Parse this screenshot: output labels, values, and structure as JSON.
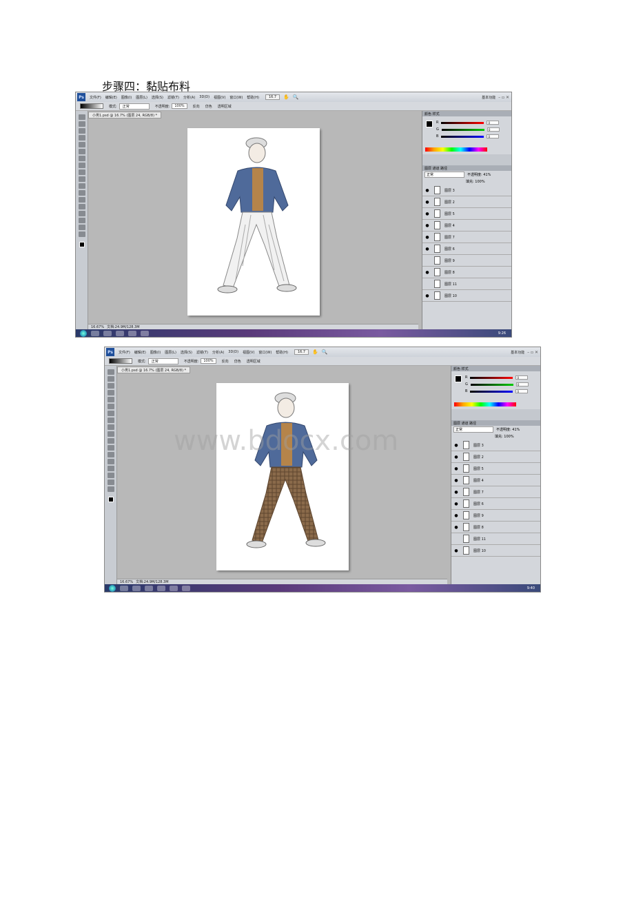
{
  "heading": "步骤四：黏贴布料",
  "watermark": "www.bdocx.com",
  "menu": [
    "文件(F)",
    "编辑(E)",
    "图像(I)",
    "图层(L)",
    "选择(S)",
    "滤镜(T)",
    "分析(A)",
    "3D(D)",
    "视图(V)",
    "窗口(W)",
    "帮助(H)"
  ],
  "zoom_menu": "16.7",
  "workspace": "基本功能",
  "options": {
    "mode_label": "模式:",
    "mode_value": "正常",
    "opacity_label": "不透明度:",
    "opacity_value": "100%",
    "reverse": "反向",
    "dither": "仿色",
    "transparency": "透明区域"
  },
  "doc_tab": "小男1.psd @ 16.7% (图层 24, RGB/8) *",
  "status": {
    "zoom": "16.67%",
    "doc": "文档:24.9M/128.3M"
  },
  "color_panel": {
    "tabs": "颜色  样式",
    "r": "0",
    "g": "0",
    "b": "0"
  },
  "layers_panel": {
    "tabs": "图层  通道  路径",
    "blend": "正常",
    "opacity": "不透明度: 41%",
    "fill": "填充: 100%",
    "layers": [
      "图层 3",
      "图层 2",
      "图层 5",
      "图层 4",
      "图层 7",
      "图层 6",
      "图层 9",
      "图层 8",
      "图层 11",
      "图层 10"
    ]
  },
  "clock_1": "9:26",
  "clock_2": "9:40",
  "colors": {
    "jacket": "#4f6a9a",
    "jacket_dark": "#34486e",
    "vest": "#b5844a",
    "plaid": "#8a6a4a"
  }
}
